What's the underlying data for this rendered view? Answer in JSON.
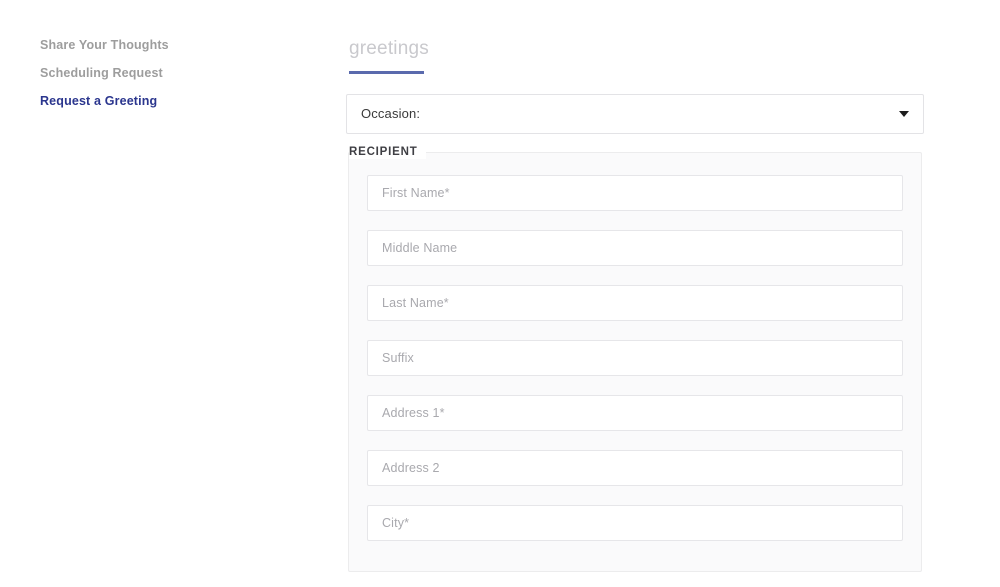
{
  "sidebar": {
    "items": [
      {
        "label": "Share Your Thoughts",
        "active": false
      },
      {
        "label": "Scheduling Request",
        "active": false
      },
      {
        "label": "Request a Greeting",
        "active": true
      }
    ]
  },
  "main": {
    "tabs": [
      {
        "label": "greetings",
        "active": true
      }
    ],
    "occasion_select": {
      "value": "Occasion:",
      "arrow_icon": "chevron-down-icon"
    },
    "recipient_fieldset": {
      "legend": "RECIPIENT",
      "fields": [
        {
          "name": "first-name",
          "placeholder": "First Name*",
          "value": ""
        },
        {
          "name": "middle-name",
          "placeholder": "Middle Name",
          "value": ""
        },
        {
          "name": "last-name",
          "placeholder": "Last Name*",
          "value": ""
        },
        {
          "name": "suffix",
          "placeholder": "Suffix",
          "value": ""
        },
        {
          "name": "address-1",
          "placeholder": "Address 1*",
          "value": ""
        },
        {
          "name": "address-2",
          "placeholder": "Address 2",
          "value": ""
        },
        {
          "name": "city",
          "placeholder": "City*",
          "value": ""
        }
      ]
    }
  },
  "colors": {
    "accent": "#2b368e",
    "tab_underline": "#5a6aad",
    "inactive_nav": "#9d9d9d",
    "tab_text": "#c9c9cd",
    "field_border": "#e6e6e9",
    "fieldset_bg": "#fafafb",
    "placeholder": "#a9a9ae"
  }
}
